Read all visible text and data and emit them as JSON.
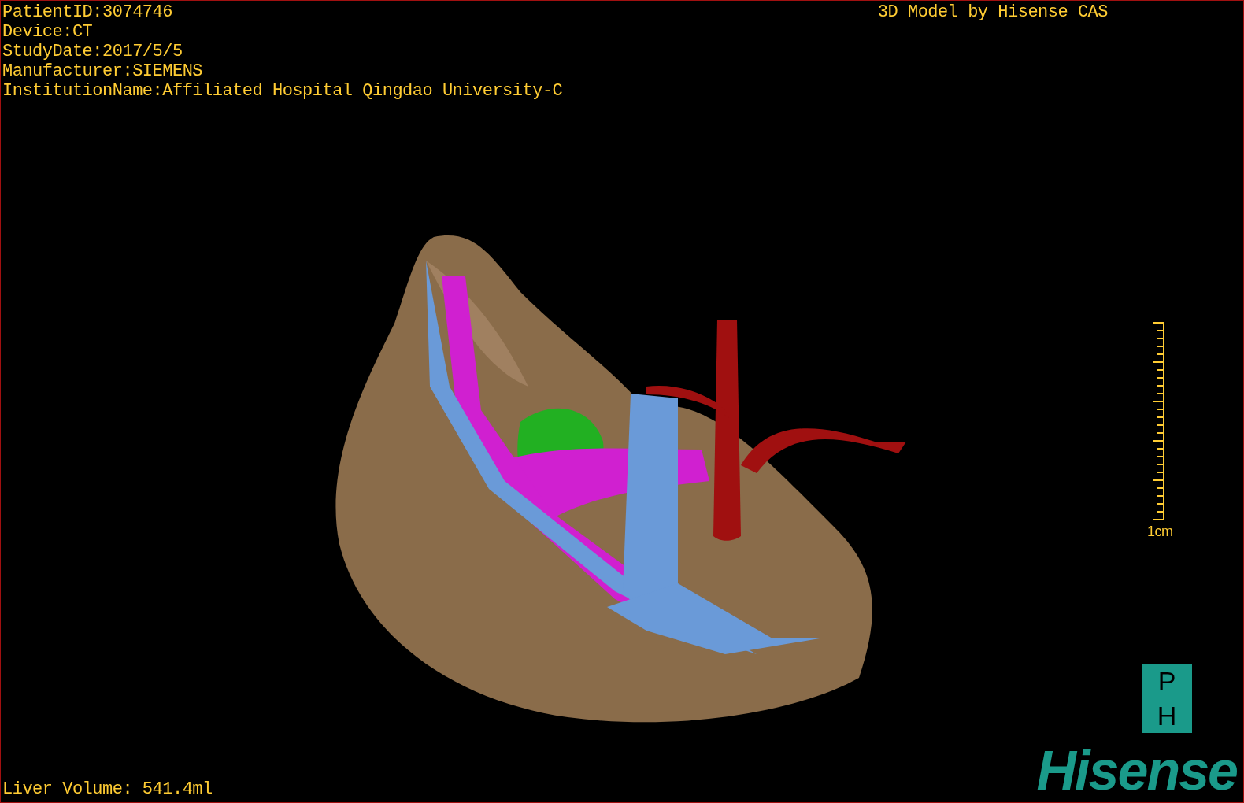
{
  "info_lines": [
    "PatientID:3074746",
    "Device:CT",
    "StudyDate:2017/5/5",
    "Manufacturer:SIEMENS",
    "InstitutionName:Affiliated Hospital Qingdao University-C"
  ],
  "model_credit": "3D Model by Hisense CAS",
  "scale_bar": {
    "label": "1cm"
  },
  "orientation_marker": [
    "P",
    "H"
  ],
  "logo": "Hisense",
  "liver_volume": "Liver Volume: 541.4ml"
}
